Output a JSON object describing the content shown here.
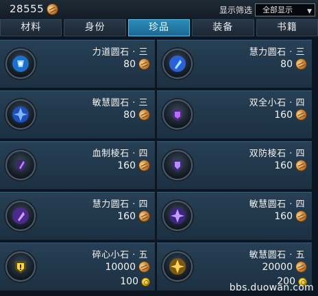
{
  "header": {
    "currency_amount": "28555",
    "filter_label": "显示筛选",
    "filter_value": "全部显示"
  },
  "tabs": [
    {
      "label": "材料",
      "active": false
    },
    {
      "label": "身份",
      "active": false
    },
    {
      "label": "珍品",
      "active": true
    },
    {
      "label": "装备",
      "active": false
    },
    {
      "label": "书籍",
      "active": false
    }
  ],
  "items": [
    {
      "name": "力道圆石 · 三",
      "price": "80",
      "icon": "blue-power-gem-icon"
    },
    {
      "name": "慧力圆石 · 三",
      "price": "80",
      "icon": "blue-wisdom-gem-icon"
    },
    {
      "name": "敏慧圆石 · 三",
      "price": "80",
      "icon": "blue-agility-gem-icon"
    },
    {
      "name": "双全小石 · 四",
      "price": "160",
      "icon": "purple-dual-stone-icon"
    },
    {
      "name": "血制棱石 · 四",
      "price": "160",
      "icon": "purple-blood-prism-icon"
    },
    {
      "name": "双防棱石 · 四",
      "price": "160",
      "icon": "purple-defense-prism-icon"
    },
    {
      "name": "慧力圆石 · 四",
      "price": "160",
      "icon": "purple-wisdom-gem-icon"
    },
    {
      "name": "敏慧圆石 · 四",
      "price": "160",
      "icon": "purple-agility-gem-icon"
    },
    {
      "name": "碎心小石 · 五",
      "price": "10000",
      "price2": "100",
      "icon": "gold-heartbreak-stone-icon"
    },
    {
      "name": "敏慧圆石 · 五",
      "price": "20000",
      "price2": "200",
      "icon": "gold-agility-gem-icon"
    }
  ],
  "watermark": "bbs.duowan.com",
  "colors": {
    "active_tab": "#2389b5",
    "card_bg": "#223a4f",
    "page_bg": "#0b1622"
  }
}
